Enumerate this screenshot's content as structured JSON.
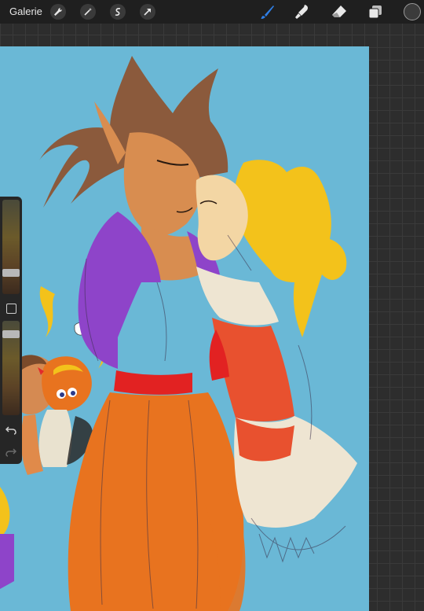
{
  "toolbar": {
    "gallery_label": "Galerie"
  },
  "icons": {
    "left_tools": [
      "wrench-icon",
      "magic-wand-icon",
      "selection-icon",
      "transform-arrow-icon"
    ],
    "right_tools": [
      "brush-icon",
      "smudge-icon",
      "eraser-icon",
      "layers-icon"
    ]
  },
  "colors": {
    "canvas": "#6ab8d6",
    "active_tool": "#2f7fe6",
    "current_color": "#3b3b3b"
  },
  "sidebar": {
    "brush_size_level": 0.3,
    "opacity_level": 0.2
  }
}
